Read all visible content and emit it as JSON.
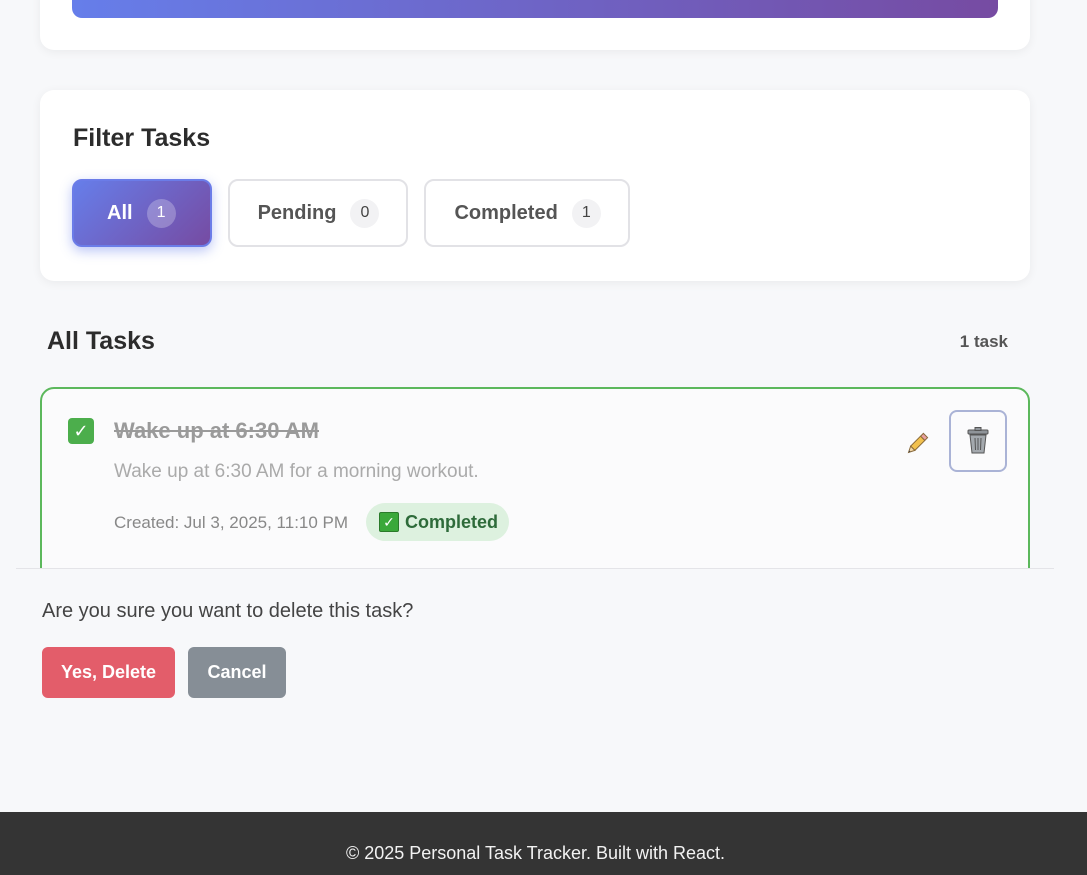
{
  "filter": {
    "title": "Filter Tasks",
    "buttons": [
      {
        "label": "All",
        "count": "1",
        "active": true
      },
      {
        "label": "Pending",
        "count": "0",
        "active": false
      },
      {
        "label": "Completed",
        "count": "1",
        "active": false
      }
    ]
  },
  "tasks": {
    "title": "All Tasks",
    "count_label": "1 task",
    "items": [
      {
        "title": "Wake up at 6:30 AM",
        "description": "Wake up at 6:30 AM for a morning workout.",
        "created": "Created: Jul 3, 2025, 11:10 PM",
        "status": "Completed",
        "completed": true
      }
    ]
  },
  "confirm": {
    "message": "Are you sure you want to delete this task?",
    "yes_label": "Yes, Delete",
    "cancel_label": "Cancel"
  },
  "footer": {
    "text": "© 2025 Personal Task Tracker. Built with React."
  },
  "icons": {
    "task_check": "checkbox-checked-icon",
    "badge_check": "check-mark-icon",
    "edit": "pencil-icon",
    "delete": "trash-icon"
  },
  "colors": {
    "accent_gradient_start": "#667eea",
    "accent_gradient_end": "#764ba2",
    "completed_border": "#5cb85c",
    "delete_button": "#e35d6a",
    "cancel_button": "#868e96",
    "footer_bg": "#343434"
  }
}
